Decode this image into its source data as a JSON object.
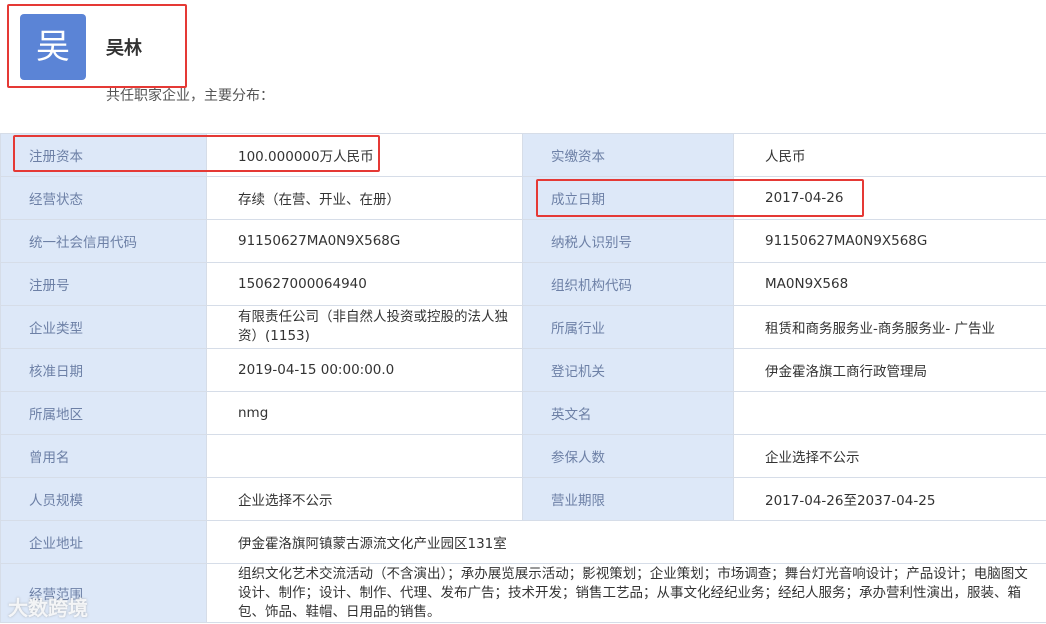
{
  "person": {
    "avatar_char": "吴",
    "name": "吴林",
    "subtitle": "共任职家企业，主要分布："
  },
  "table": {
    "registered_capital": {
      "label": "注册资本",
      "value": "100.000000万人民币"
    },
    "paid_in_capital": {
      "label": "实缴资本",
      "value": "人民币"
    },
    "operating_status": {
      "label": "经营状态",
      "value": "存续（在营、开业、在册）"
    },
    "established_date": {
      "label": "成立日期",
      "value": "2017-04-26"
    },
    "credit_code": {
      "label": "统一社会信用代码",
      "value": "91150627MA0N9X568G"
    },
    "taxpayer_id": {
      "label": "纳税人识别号",
      "value": "91150627MA0N9X568G"
    },
    "reg_number": {
      "label": "注册号",
      "value": "150627000064940"
    },
    "org_code": {
      "label": "组织机构代码",
      "value": "MA0N9X568"
    },
    "company_type": {
      "label": "企业类型",
      "value": "有限责任公司（非自然人投资或控股的法人独资）(1153)"
    },
    "industry": {
      "label": "所属行业",
      "value": "租赁和商务服务业-商务服务业- 广告业"
    },
    "approval_date": {
      "label": "核准日期",
      "value": "2019-04-15 00:00:00.0"
    },
    "registration_authority": {
      "label": "登记机关",
      "value": "伊金霍洛旗工商行政管理局"
    },
    "region": {
      "label": "所属地区",
      "value": "nmg"
    },
    "english_name": {
      "label": "英文名",
      "value": ""
    },
    "former_name": {
      "label": "曾用名",
      "value": ""
    },
    "insured_count": {
      "label": "参保人数",
      "value": "企业选择不公示"
    },
    "staff_size": {
      "label": "人员规模",
      "value": "企业选择不公示"
    },
    "business_term": {
      "label": "营业期限",
      "value": "2017-04-26至2037-04-25"
    },
    "address": {
      "label": "企业地址",
      "value": "伊金霍洛旗阿镇蒙古源流文化产业园区131室"
    },
    "business_scope": {
      "label": "经营范围",
      "value": "组织文化艺术交流活动（不含演出）；承办展览展示活动；影视策划；企业策划；市场调查；舞台灯光音响设计；产品设计；电脑图文设计、制作；设计、制作、代理、发布广告；技术开发；销售工艺品；从事文化经纪业务；经纪人服务；承办营利性演出，服装、箱包、饰品、鞋帽、日用品的销售。"
    }
  },
  "watermark": "大数跨境"
}
